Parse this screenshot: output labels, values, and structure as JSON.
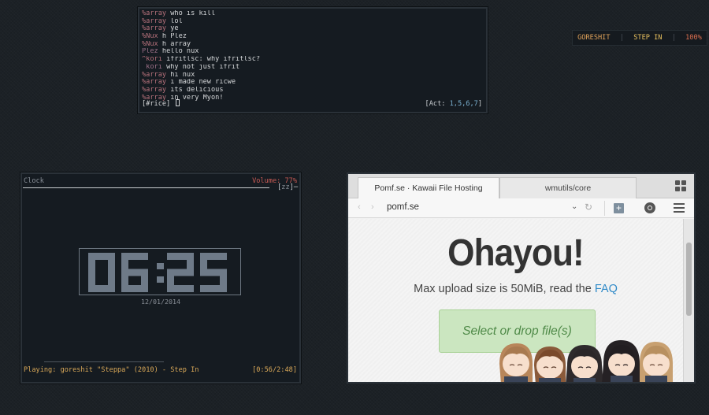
{
  "irc": {
    "lines": [
      {
        "nick": "%array",
        "msg": "who is kill"
      },
      {
        "nick": "%array",
        "msg": "lol"
      },
      {
        "nick": "%array",
        "msg": "ye"
      },
      {
        "nick": "%Nux",
        "msg": "h Plez"
      },
      {
        "nick": "%Nux",
        "msg": "h array"
      },
      {
        "nick": "Plez",
        "msg": "hello nux"
      },
      {
        "nick": "^kori",
        "msg": "ifritlsc: why ifritlsc?"
      },
      {
        "nick": " kori",
        "msg": "why not just ifrit"
      },
      {
        "nick": "%array",
        "msg": "hi nux"
      },
      {
        "nick": "%array",
        "msg": "i made new ricwe"
      },
      {
        "nick": "%array",
        "msg": "its delicious"
      },
      {
        "nick": "%array",
        "msg": "in very Myon!"
      }
    ],
    "input_prompt": "[#rice]",
    "activity_prefix": "[Act: ",
    "activity_numbers": "1,5,6,7",
    "activity_suffix": "]"
  },
  "statusbar": {
    "artist": "GORESHIT",
    "title": "STEP IN",
    "volume": "100%"
  },
  "clock_panel": {
    "label": "Clock",
    "volume": "Volume: 77%",
    "zz_left": "[",
    "zz_inner": "zz",
    "zz_right": "]─",
    "time": "06:25",
    "date": "12/01/2014",
    "now_playing": "Playing: goreshit \"Steppa\" (2010) - Step In",
    "progress": "[0:56/2:48]"
  },
  "browser": {
    "tabs": [
      {
        "label": "Pomf.se · Kawaii File Hosting",
        "active": true
      },
      {
        "label": "wmutils/core",
        "active": false
      }
    ],
    "url": "pomf.se",
    "heading": "Ohayou!",
    "subline_text": "Max upload size is 50MiB, read the ",
    "subline_link": "FAQ",
    "upload_button": "Select or drop file(s)",
    "icons": {
      "back": "back-arrow-icon",
      "forward": "forward-arrow-icon",
      "dropdown": "chevron-down-icon",
      "reload": "reload-icon",
      "addon": "plus-icon",
      "history": "history-icon",
      "menu": "hamburger-menu-icon",
      "tabs": "tab-grid-icon"
    }
  },
  "colors": {
    "background": "#1c2126",
    "panel_bg": "#151b21",
    "nick": "#b4707a",
    "accent_orange": "#e0a25a",
    "link_blue": "#2f8ac8",
    "upload_green": "#cbe6c0"
  }
}
